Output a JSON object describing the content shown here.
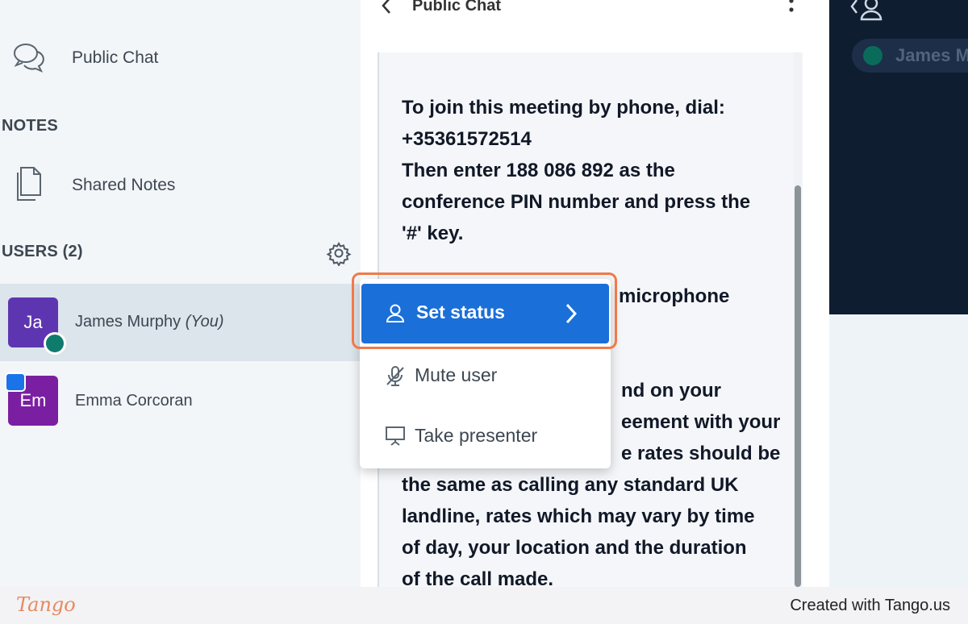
{
  "sidebar": {
    "public_chat_label": "Public Chat",
    "notes_section_title": "NOTES",
    "shared_notes_label": "Shared Notes",
    "users_section_title": "USERS (2)",
    "users": [
      {
        "initials": "Ja",
        "name": "James Murphy",
        "suffix": "(You)",
        "avatar_color": "#5e35b1",
        "badge_color": "#0f7b6c"
      },
      {
        "initials": "Em",
        "name": "Emma Corcoran",
        "suffix": "",
        "avatar_color": "#7b1fa2",
        "badge_color": "#1a73e8"
      }
    ]
  },
  "chat": {
    "title": "Public Chat",
    "message_lines_top": [
      "To join this meeting by phone, dial:",
      "+35361572514",
      "Then enter 188 086 892 as the",
      "conference PIN number and press the",
      "'#' key."
    ],
    "message_partial_1": "microphone",
    "message_partial_2": "nd on your",
    "message_partial_3": "eement with your",
    "message_partial_4": "e rates should be",
    "message_lines_bottom": [
      "the same as calling any standard UK",
      "landline, rates which may vary by time",
      "of day, your location and the duration",
      "of the call made."
    ]
  },
  "context_menu": {
    "items": [
      {
        "label": "Set status",
        "icon": "user-icon"
      },
      {
        "label": "Mute user",
        "icon": "microphone-off-icon"
      },
      {
        "label": "Take presenter",
        "icon": "presentation-icon"
      }
    ],
    "accent_color": "#1a6fd8",
    "highlight_color": "#ef7a4a"
  },
  "presentation": {
    "talking_indicator_name": "James M"
  },
  "footer": {
    "logo_text": "Tango",
    "credit": "Created with Tango.us"
  }
}
